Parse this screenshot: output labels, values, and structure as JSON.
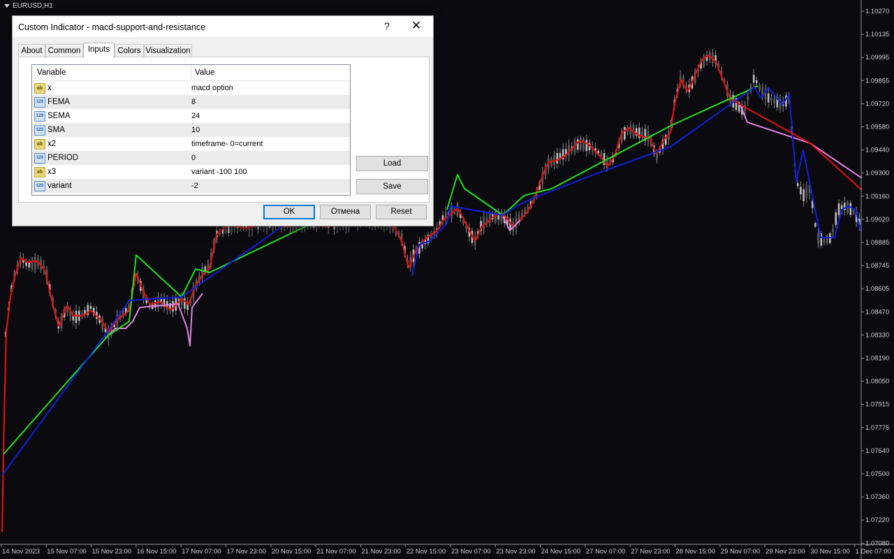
{
  "chart": {
    "symbol_title": "EURUSD,H1",
    "price_labels": [
      "1.10270",
      "1.10135",
      "1.09995",
      "1.09855",
      "1.09720",
      "1.09580",
      "1.09440",
      "1.09300",
      "1.09160",
      "1.09020",
      "1.08885",
      "1.08745",
      "1.08605",
      "1.08470",
      "1.08330",
      "1.08190",
      "1.08050",
      "1.07915",
      "1.07775",
      "1.07640",
      "1.07500",
      "1.07360",
      "1.07220",
      "1.07080"
    ],
    "time_labels": [
      "14 Nov 2023",
      "15 Nov 07:00",
      "15 Nov 23:00",
      "16 Nov 15:00",
      "17 Nov 07:00",
      "17 Nov 23:00",
      "20 Nov 15:00",
      "21 Nov 07:00",
      "21 Nov 23:00",
      "22 Nov 15:00",
      "23 Nov 07:00",
      "23 Nov 23:00",
      "24 Nov 15:00",
      "27 Nov 07:00",
      "27 Nov 23:00",
      "28 Nov 15:00",
      "29 Nov 07:00",
      "29 Nov 23:00",
      "30 Nov 15:00",
      "1 Dec 07:00"
    ],
    "colors": {
      "background": "#0b0a0e",
      "candle": "#8a8a8a",
      "red_line": "#e01010",
      "blue_line": "#1020e0",
      "green_line": "#20e020",
      "violet_line": "#e080e0"
    }
  },
  "dialog": {
    "title": "Custom Indicator - macd-support-and-resistance",
    "help": "?",
    "close": "✕",
    "tabs": [
      "About",
      "Common",
      "Inputs",
      "Colors",
      "Visualization"
    ],
    "active_tab": "Inputs",
    "columns": {
      "variable": "Variable",
      "value": "Value"
    },
    "params": [
      {
        "type": "ab",
        "name": "x",
        "value": "macd option"
      },
      {
        "type": "123",
        "name": "FEMA",
        "value": "8"
      },
      {
        "type": "123",
        "name": "SEMA",
        "value": "24"
      },
      {
        "type": "123",
        "name": "SMA",
        "value": "10"
      },
      {
        "type": "ab",
        "name": "x2",
        "value": "timeframe- 0=current"
      },
      {
        "type": "123",
        "name": "PERIOD",
        "value": "0"
      },
      {
        "type": "ab",
        "name": "x3",
        "value": "variant -100  100"
      },
      {
        "type": "123",
        "name": "variant",
        "value": "-2"
      }
    ],
    "load": "Load",
    "save": "Save",
    "ok": "OK",
    "cancel": "Отмена",
    "reset": "Reset"
  }
}
